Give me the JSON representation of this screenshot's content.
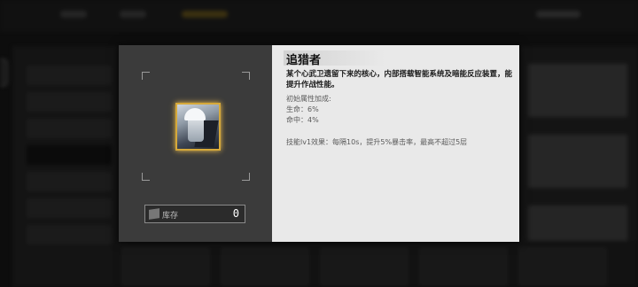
{
  "item": {
    "name": "追猎者",
    "description": "某个心武卫遗留下来的核心，内部搭载智能系统及暗能反应装置，能提升作战性能。",
    "base_stats_heading": "初始属性加成:",
    "stats": [
      {
        "text": "生命：6%"
      },
      {
        "text": "命中：4%"
      }
    ],
    "skill_text": "技能lv1效果：每隔10s，提升5%暴击率，最高不超过5层"
  },
  "inventory": {
    "label": "库存",
    "count": "0"
  },
  "colors": {
    "frame_gold": "#d6a93a",
    "panel_dark": "#3b3b3b",
    "panel_light": "#e9e9e9"
  }
}
